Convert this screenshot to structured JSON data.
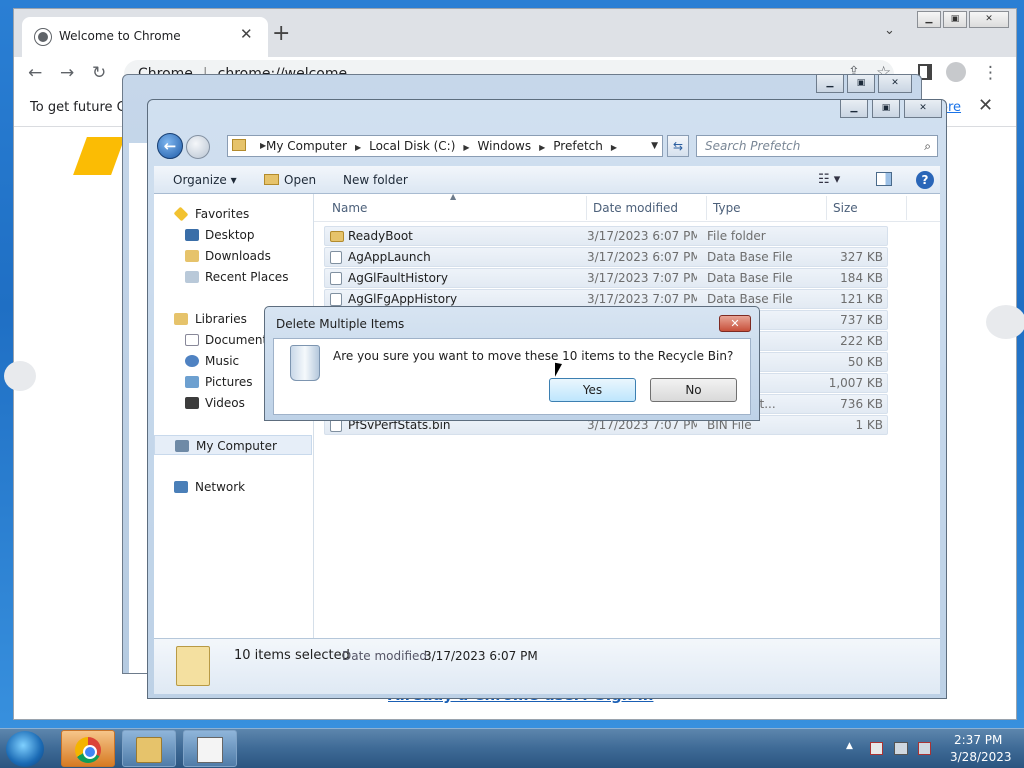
{
  "chrome": {
    "tab_title": "Welcome to Chrome",
    "tab_close": "✕",
    "new_tab": "+",
    "tab_search": "⌄",
    "omnibox_site": "Chrome",
    "omnibox_url": "chrome://welcome",
    "infobar_text": "To get future Go",
    "infobar_more": "ore",
    "infobar_close": "✕",
    "signin_link": "Already a Chrome user? Sign in",
    "nav_back": "←",
    "nav_forward": "→",
    "nav_reload": "↻",
    "share": "⇪",
    "star": "☆",
    "menu": "⋮"
  },
  "explorer": {
    "breadcrumb": [
      "My Computer",
      "Local Disk (C:)",
      "Windows",
      "Prefetch"
    ],
    "search_placeholder": "Search Prefetch",
    "toolbar": {
      "organize": "Organize ▾",
      "open": "Open",
      "new_folder": "New folder",
      "views": "☷ ▾",
      "help": "?"
    },
    "nav": {
      "favorites": "Favorites",
      "desktop": "Desktop",
      "downloads": "Downloads",
      "recent_places": "Recent Places",
      "libraries": "Libraries",
      "documents": "Documents",
      "music": "Music",
      "pictures": "Pictures",
      "videos": "Videos",
      "my_computer": "My Computer",
      "network": "Network"
    },
    "columns": {
      "name": "Name",
      "date": "Date modified",
      "type": "Type",
      "size": "Size"
    },
    "files": [
      {
        "name": "ReadyBoot",
        "date": "3/17/2023 6:07 PM",
        "type": "File folder",
        "size": ""
      },
      {
        "name": "AgAppLaunch",
        "date": "3/17/2023 6:07 PM",
        "type": "Data Base File",
        "size": "327 KB"
      },
      {
        "name": "AgGlFaultHistory",
        "date": "3/17/2023 7:07 PM",
        "type": "Data Base File",
        "size": "184 KB"
      },
      {
        "name": "AgGlFgAppHistory",
        "date": "3/17/2023 7:07 PM",
        "type": "Data Base File",
        "size": "121 KB"
      },
      {
        "name": "",
        "date": "",
        "type": "e File",
        "size": "737 KB"
      },
      {
        "name": "",
        "date": "",
        "type": "e File",
        "size": "222 KB"
      },
      {
        "name": "",
        "date": "",
        "type": "e File",
        "size": "50 KB"
      },
      {
        "name": "",
        "date": "",
        "type": "e File",
        "size": "1,007 KB"
      },
      {
        "name": "",
        "date": "",
        "type": "ation sett...",
        "size": "736 KB"
      },
      {
        "name": "PfSvPerfStats.bin",
        "date": "3/17/2023 7:07 PM",
        "type": "BIN File",
        "size": "1 KB"
      }
    ],
    "details": {
      "count": "10 items selected",
      "date_label": "Date modified:",
      "date_value": "3/17/2023 6:07 PM"
    }
  },
  "dialog": {
    "title": "Delete Multiple Items",
    "close": "✕",
    "question": "Are you sure you want to move these 10 items to the Recycle Bin?",
    "yes": "Yes",
    "no": "No"
  },
  "tray": {
    "time": "2:37 PM",
    "date": "3/28/2023",
    "arrow": "▲"
  }
}
